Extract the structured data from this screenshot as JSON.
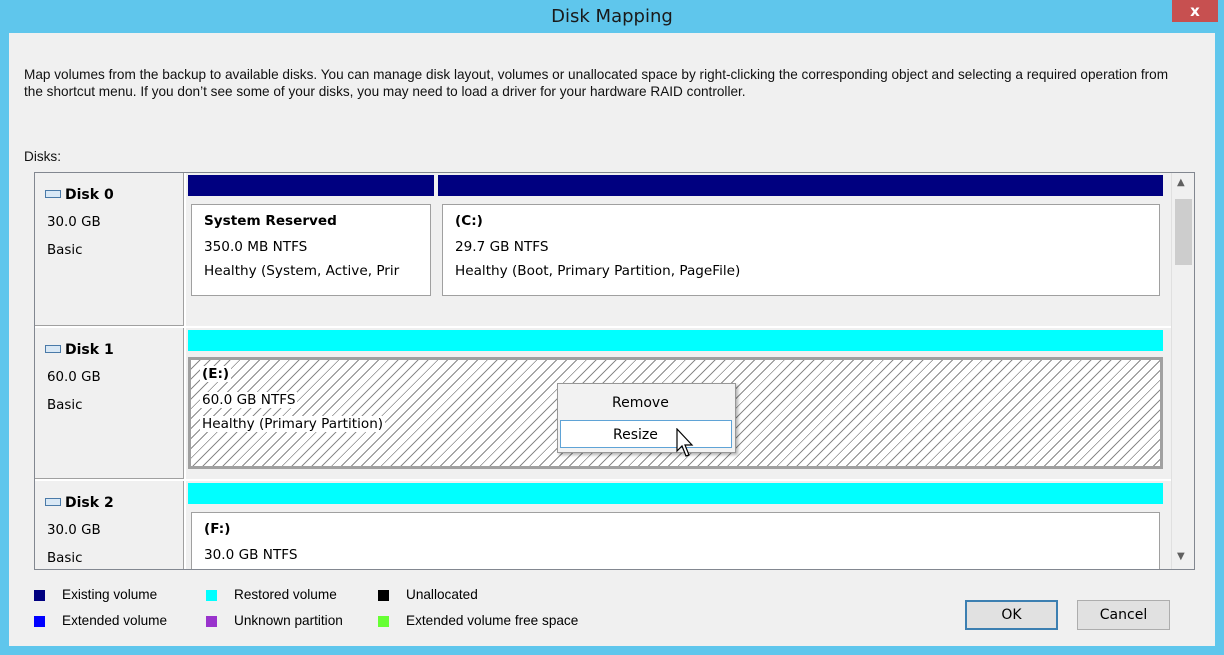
{
  "window": {
    "title": "Disk Mapping",
    "close_label": "x"
  },
  "description": "Map volumes from the backup to available disks. You can manage disk layout, volumes or unallocated space by right-clicking the corresponding object and selecting a required operation from the shortcut menu. If you don’t see some of your disks, you may need to load a driver for your hardware RAID controller.",
  "disks_label": "Disks:",
  "disks": [
    {
      "name": "Disk 0",
      "size": "30.0 GB",
      "type": "Basic",
      "volumes": [
        {
          "name": "System Reserved",
          "fs": "350.0 MB NTFS",
          "status": "Healthy (System, Active, Prir",
          "bar_color": "#000080"
        },
        {
          "name": "(C:)",
          "fs": "29.7 GB NTFS",
          "status": "Healthy (Boot, Primary Partition, PageFile)",
          "bar_color": "#000080"
        }
      ]
    },
    {
      "name": "Disk 1",
      "size": "60.0 GB",
      "type": "Basic",
      "volumes": [
        {
          "name": "(E:)",
          "fs": "60.0 GB NTFS",
          "status": "Healthy (Primary Partition)",
          "bar_color": "#00ffff"
        }
      ]
    },
    {
      "name": "Disk 2",
      "size": "30.0 GB",
      "type": "Basic",
      "volumes": [
        {
          "name": "(F:)",
          "fs": "30.0 GB NTFS",
          "status": "",
          "bar_color": "#00ffff"
        }
      ]
    }
  ],
  "context_menu": {
    "items": [
      "Remove",
      "Resize"
    ],
    "hovered": "Resize"
  },
  "legend": [
    {
      "label": "Existing volume",
      "color": "#000080"
    },
    {
      "label": "Restored volume",
      "color": "#00ffff"
    },
    {
      "label": "Unallocated",
      "color": "#000000"
    },
    {
      "label": "Extended volume",
      "color": "#0000ff"
    },
    {
      "label": "Unknown partition",
      "color": "#9933cc"
    },
    {
      "label": "Extended volume free space",
      "color": "#66ff33"
    }
  ],
  "buttons": {
    "ok": "OK",
    "cancel": "Cancel"
  }
}
